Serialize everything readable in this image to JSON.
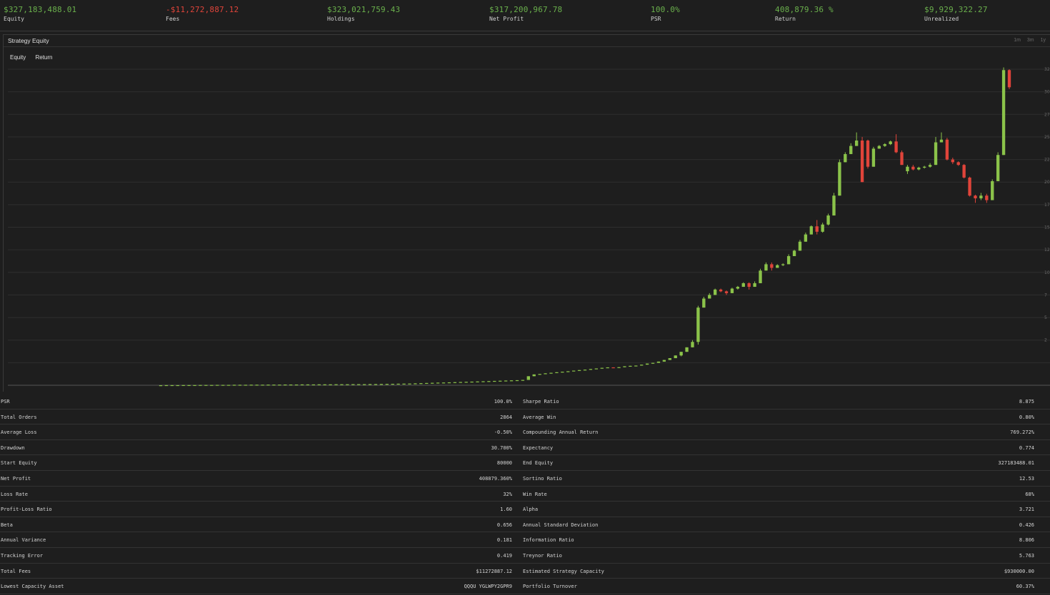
{
  "top_stats": [
    {
      "value": "$327,183,488.01",
      "label": "Equity",
      "status": "positive"
    },
    {
      "value": "-$11,272,887.12",
      "label": "Fees",
      "status": "negative"
    },
    {
      "value": "$323,021,759.43",
      "label": "Holdings",
      "status": "positive"
    },
    {
      "value": "$317,200,967.78",
      "label": "Net Profit",
      "status": "positive"
    },
    {
      "value": "100.0%",
      "label": "PSR",
      "status": "positive"
    },
    {
      "value": "408,879.36 %",
      "label": "Return",
      "status": "positive"
    },
    {
      "value": "$9,929,322.27",
      "label": "Unrealized",
      "status": "positive"
    }
  ],
  "chart_panel": {
    "title": "Strategy Equity",
    "tabs": [
      "Equity",
      "Return"
    ],
    "range_buttons": [
      "1m",
      "3m",
      "1y"
    ]
  },
  "chart_data": {
    "type": "candlestick",
    "title": "Strategy Equity",
    "y_tick_labels": [
      "32",
      "30",
      "27",
      "25",
      "22",
      "20",
      "17",
      "15",
      "12",
      "10",
      "7",
      "5",
      "2"
    ],
    "ylim": [
      0,
      35
    ],
    "colors": {
      "up": "#8bc34a",
      "down": "#e0443a"
    },
    "candles": [
      [
        0.0,
        0.0,
        0.0,
        0.0
      ],
      [
        0.0,
        0.01,
        0.0,
        0.01
      ],
      [
        0.01,
        0.01,
        0.0,
        0.01
      ],
      [
        0.01,
        0.01,
        0.01,
        0.01
      ],
      [
        0.01,
        0.02,
        0.01,
        0.02
      ],
      [
        0.02,
        0.02,
        0.01,
        0.02
      ],
      [
        0.02,
        0.02,
        0.02,
        0.02
      ],
      [
        0.02,
        0.03,
        0.02,
        0.03
      ],
      [
        0.03,
        0.03,
        0.02,
        0.03
      ],
      [
        0.03,
        0.03,
        0.03,
        0.03
      ],
      [
        0.03,
        0.04,
        0.03,
        0.04
      ],
      [
        0.04,
        0.04,
        0.03,
        0.04
      ],
      [
        0.04,
        0.04,
        0.04,
        0.04
      ],
      [
        0.04,
        0.05,
        0.04,
        0.05
      ],
      [
        0.05,
        0.05,
        0.04,
        0.05
      ],
      [
        0.05,
        0.05,
        0.05,
        0.05
      ],
      [
        0.05,
        0.06,
        0.05,
        0.06
      ],
      [
        0.06,
        0.06,
        0.05,
        0.06
      ],
      [
        0.06,
        0.06,
        0.06,
        0.06
      ],
      [
        0.06,
        0.07,
        0.06,
        0.07
      ],
      [
        0.07,
        0.07,
        0.06,
        0.07
      ],
      [
        0.07,
        0.07,
        0.07,
        0.07
      ],
      [
        0.07,
        0.08,
        0.07,
        0.08
      ],
      [
        0.08,
        0.08,
        0.07,
        0.08
      ],
      [
        0.08,
        0.08,
        0.08,
        0.08
      ],
      [
        0.08,
        0.09,
        0.08,
        0.09
      ],
      [
        0.09,
        0.09,
        0.08,
        0.09
      ],
      [
        0.09,
        0.09,
        0.09,
        0.09
      ],
      [
        0.09,
        0.1,
        0.09,
        0.1
      ],
      [
        0.1,
        0.1,
        0.09,
        0.1
      ],
      [
        0.1,
        0.1,
        0.1,
        0.1
      ],
      [
        0.1,
        0.11,
        0.1,
        0.11
      ],
      [
        0.11,
        0.11,
        0.1,
        0.11
      ],
      [
        0.11,
        0.11,
        0.11,
        0.11
      ],
      [
        0.11,
        0.12,
        0.11,
        0.12
      ],
      [
        0.12,
        0.12,
        0.11,
        0.12
      ],
      [
        0.12,
        0.12,
        0.12,
        0.12
      ],
      [
        0.12,
        0.13,
        0.12,
        0.13
      ],
      [
        0.13,
        0.13,
        0.12,
        0.13
      ],
      [
        0.13,
        0.14,
        0.13,
        0.14
      ],
      [
        0.14,
        0.15,
        0.14,
        0.15
      ],
      [
        0.15,
        0.16,
        0.15,
        0.16
      ],
      [
        0.16,
        0.17,
        0.16,
        0.17
      ],
      [
        0.17,
        0.18,
        0.17,
        0.18
      ],
      [
        0.18,
        0.19,
        0.18,
        0.19
      ],
      [
        0.19,
        0.21,
        0.19,
        0.21
      ],
      [
        0.21,
        0.23,
        0.21,
        0.23
      ],
      [
        0.23,
        0.25,
        0.23,
        0.25
      ],
      [
        0.25,
        0.27,
        0.25,
        0.27
      ],
      [
        0.27,
        0.29,
        0.27,
        0.29
      ],
      [
        0.29,
        0.3,
        0.28,
        0.3
      ],
      [
        0.3,
        0.32,
        0.3,
        0.32
      ],
      [
        0.32,
        0.34,
        0.32,
        0.34
      ],
      [
        0.34,
        0.36,
        0.34,
        0.36
      ],
      [
        0.36,
        0.38,
        0.36,
        0.38
      ],
      [
        0.38,
        0.4,
        0.38,
        0.4
      ],
      [
        0.4,
        0.42,
        0.4,
        0.42
      ],
      [
        0.42,
        0.44,
        0.42,
        0.44
      ],
      [
        0.44,
        0.46,
        0.44,
        0.46
      ],
      [
        0.46,
        0.48,
        0.46,
        0.48
      ],
      [
        0.48,
        0.5,
        0.48,
        0.5
      ],
      [
        0.5,
        0.52,
        0.5,
        0.52
      ],
      [
        0.52,
        0.54,
        0.52,
        0.54
      ],
      [
        0.54,
        0.56,
        0.54,
        0.56
      ],
      [
        0.56,
        0.59,
        0.56,
        0.59
      ],
      [
        0.59,
        1.0,
        0.59,
        1.0
      ],
      [
        1.0,
        1.2,
        1.0,
        1.2
      ],
      [
        1.2,
        1.25,
        1.2,
        1.25
      ],
      [
        1.25,
        1.32,
        1.25,
        1.32
      ],
      [
        1.32,
        1.38,
        1.32,
        1.38
      ],
      [
        1.38,
        1.44,
        1.38,
        1.44
      ],
      [
        1.44,
        1.5,
        1.44,
        1.5
      ],
      [
        1.5,
        1.55,
        1.5,
        1.55
      ],
      [
        1.55,
        1.62,
        1.55,
        1.62
      ],
      [
        1.62,
        1.68,
        1.62,
        1.68
      ],
      [
        1.68,
        1.73,
        1.68,
        1.73
      ],
      [
        1.73,
        1.8,
        1.73,
        1.8
      ],
      [
        1.8,
        1.86,
        1.8,
        1.86
      ],
      [
        1.86,
        1.93,
        1.86,
        1.93
      ],
      [
        1.93,
        1.98,
        1.93,
        1.98
      ],
      [
        1.98,
        1.95,
        1.93,
        1.98
      ],
      [
        1.95,
        2.0,
        1.95,
        2.0
      ],
      [
        2.0,
        2.1,
        2.0,
        2.1
      ],
      [
        2.1,
        2.15,
        2.1,
        2.15
      ],
      [
        2.15,
        2.18,
        2.15,
        2.18
      ],
      [
        2.18,
        2.28,
        2.18,
        2.28
      ],
      [
        2.28,
        2.4,
        2.28,
        2.4
      ],
      [
        2.4,
        2.48,
        2.4,
        2.48
      ],
      [
        2.48,
        2.62,
        2.48,
        2.62
      ],
      [
        2.62,
        2.8,
        2.62,
        2.8
      ],
      [
        2.8,
        3.0,
        2.8,
        3.0
      ],
      [
        3.0,
        3.3,
        3.0,
        3.3
      ],
      [
        3.3,
        3.7,
        3.2,
        3.7
      ],
      [
        3.7,
        4.2,
        3.7,
        4.2
      ],
      [
        4.2,
        4.8,
        4.2,
        5.0
      ],
      [
        4.8,
        8.6,
        4.5,
        8.8
      ],
      [
        8.6,
        9.6,
        8.6,
        9.8
      ],
      [
        9.6,
        10.0,
        9.6,
        10.2
      ],
      [
        10.0,
        10.6,
        10.0,
        10.7
      ],
      [
        10.6,
        10.4,
        10.3,
        10.7
      ],
      [
        10.4,
        10.2,
        10.0,
        10.5
      ],
      [
        10.2,
        10.7,
        10.2,
        10.8
      ],
      [
        10.7,
        10.9,
        10.6,
        11.0
      ],
      [
        10.9,
        11.3,
        10.9,
        11.4
      ],
      [
        11.3,
        10.9,
        10.6,
        11.4
      ],
      [
        10.9,
        11.3,
        10.9,
        11.5
      ],
      [
        11.3,
        12.7,
        11.3,
        12.9
      ],
      [
        12.7,
        13.4,
        12.7,
        13.6
      ],
      [
        13.4,
        13.0,
        12.7,
        13.6
      ],
      [
        13.0,
        13.3,
        13.0,
        13.4
      ],
      [
        13.3,
        13.4,
        13.2,
        13.5
      ],
      [
        13.4,
        14.3,
        13.4,
        14.5
      ],
      [
        14.3,
        14.9,
        14.3,
        15.0
      ],
      [
        14.9,
        15.9,
        14.9,
        16.1
      ],
      [
        15.9,
        16.7,
        15.9,
        16.9
      ],
      [
        16.7,
        17.6,
        16.7,
        17.7
      ],
      [
        17.6,
        17.0,
        16.7,
        18.3
      ],
      [
        17.0,
        17.8,
        16.9,
        18.0
      ],
      [
        17.8,
        18.8,
        17.7,
        19.0
      ],
      [
        18.8,
        21.0,
        18.8,
        21.3
      ],
      [
        21.0,
        24.7,
        21.0,
        25.0
      ],
      [
        24.7,
        25.6,
        24.7,
        25.8
      ],
      [
        25.6,
        26.5,
        25.6,
        26.8
      ],
      [
        26.5,
        27.1,
        26.5,
        28.0
      ],
      [
        27.1,
        22.5,
        22.5,
        27.5
      ],
      [
        27.1,
        24.2,
        24.0,
        27.2
      ],
      [
        24.2,
        26.2,
        24.2,
        26.4
      ],
      [
        26.2,
        26.5,
        26.2,
        26.6
      ],
      [
        26.5,
        26.7,
        26.4,
        26.8
      ],
      [
        26.7,
        27.0,
        26.6,
        27.1
      ],
      [
        27.0,
        25.8,
        25.7,
        27.8
      ],
      [
        25.8,
        24.4,
        24.4,
        26.0
      ],
      [
        23.7,
        24.2,
        23.4,
        24.4
      ],
      [
        24.2,
        23.9,
        23.8,
        24.4
      ],
      [
        23.9,
        24.1,
        23.8,
        24.2
      ],
      [
        24.1,
        24.2,
        24.0,
        24.3
      ],
      [
        24.2,
        24.4,
        24.1,
        24.6
      ],
      [
        24.4,
        26.9,
        24.4,
        27.5
      ],
      [
        26.9,
        27.2,
        26.9,
        28.0
      ],
      [
        27.2,
        25.0,
        24.9,
        27.4
      ],
      [
        25.0,
        24.7,
        24.5,
        25.2
      ],
      [
        24.7,
        24.4,
        24.3,
        24.8
      ],
      [
        24.4,
        23.0,
        22.9,
        24.5
      ],
      [
        23.0,
        21.0,
        20.9,
        23.1
      ],
      [
        21.0,
        20.7,
        20.2,
        21.1
      ],
      [
        20.7,
        21.0,
        20.5,
        21.3
      ],
      [
        21.0,
        20.5,
        20.2,
        21.2
      ],
      [
        20.5,
        22.6,
        20.5,
        22.8
      ],
      [
        22.6,
        25.5,
        22.6,
        25.8
      ],
      [
        25.5,
        34.9,
        25.5,
        35.2
      ],
      [
        34.9,
        33.0,
        32.8,
        35.0
      ]
    ]
  },
  "stats_table": [
    {
      "left_label": "PSR",
      "left_value": "100.0%",
      "right_label": "Sharpe Ratio",
      "right_value": "8.875"
    },
    {
      "left_label": "Total Orders",
      "left_value": "2864",
      "right_label": "Average Win",
      "right_value": "0.80%"
    },
    {
      "left_label": "Average Loss",
      "left_value": "-0.50%",
      "right_label": "Compounding Annual Return",
      "right_value": "769.272%"
    },
    {
      "left_label": "Drawdown",
      "left_value": "30.700%",
      "right_label": "Expectancy",
      "right_value": "0.774"
    },
    {
      "left_label": "Start Equity",
      "left_value": "80000",
      "right_label": "End Equity",
      "right_value": "327183488.01"
    },
    {
      "left_label": "Net Profit",
      "left_value": "408879.360%",
      "right_label": "Sortino Ratio",
      "right_value": "12.53"
    },
    {
      "left_label": "Loss Rate",
      "left_value": "32%",
      "right_label": "Win Rate",
      "right_value": "68%"
    },
    {
      "left_label": "Profit-Loss Ratio",
      "left_value": "1.60",
      "right_label": "Alpha",
      "right_value": "3.721"
    },
    {
      "left_label": "Beta",
      "left_value": "0.656",
      "right_label": "Annual Standard Deviation",
      "right_value": "0.426"
    },
    {
      "left_label": "Annual Variance",
      "left_value": "0.181",
      "right_label": "Information Ratio",
      "right_value": "8.806"
    },
    {
      "left_label": "Tracking Error",
      "left_value": "0.419",
      "right_label": "Treynor Ratio",
      "right_value": "5.763"
    },
    {
      "left_label": "Total Fees",
      "left_value": "$11272887.12",
      "right_label": "Estimated Strategy Capacity",
      "right_value": "$930000.00"
    },
    {
      "left_label": "Lowest Capacity Asset",
      "left_value": "QQQU YGLWPY2GPR9",
      "right_label": "Portfolio Turnover",
      "right_value": "60.37%"
    }
  ]
}
